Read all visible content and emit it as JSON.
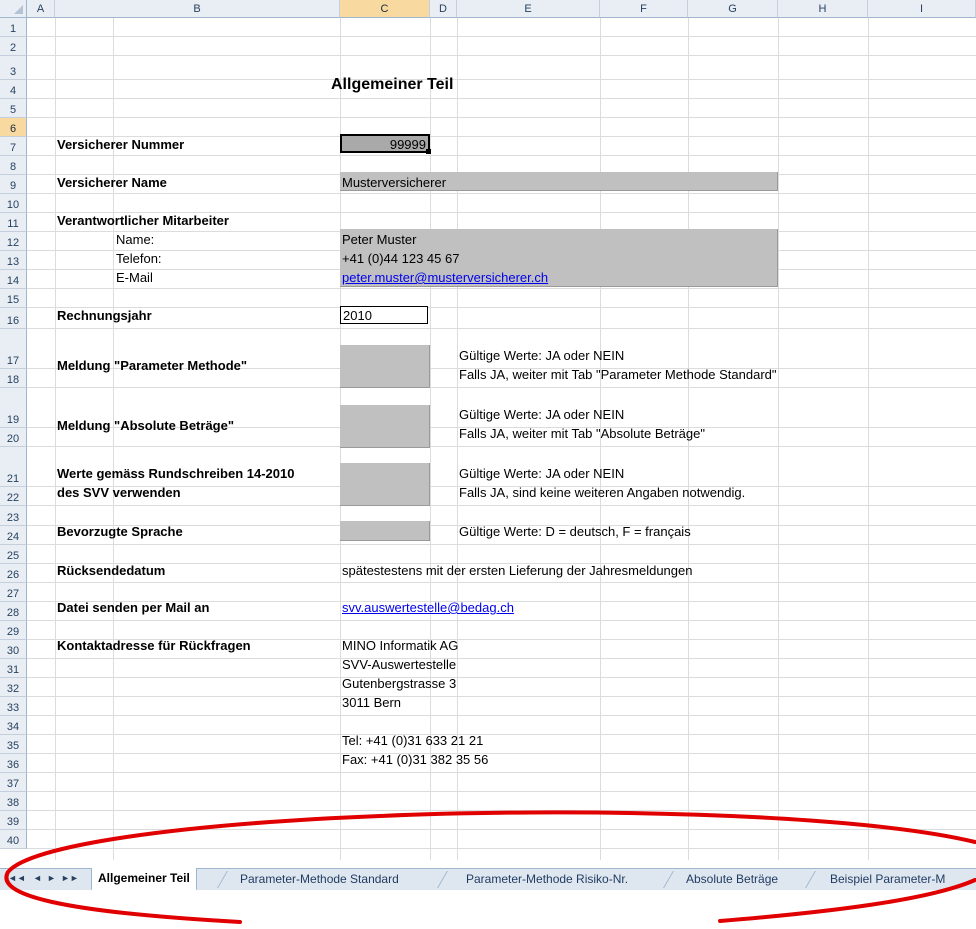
{
  "columns": [
    "A",
    "B",
    "C",
    "D",
    "E",
    "F",
    "G",
    "H",
    "I"
  ],
  "rows": [
    "1",
    "2",
    "3",
    "4",
    "5",
    "6",
    "7",
    "8",
    "9",
    "10",
    "11",
    "12",
    "13",
    "14",
    "15",
    "16",
    "17",
    "18",
    "19",
    "20",
    "21",
    "22",
    "23",
    "24",
    "25",
    "26",
    "27",
    "28",
    "29",
    "30",
    "31",
    "32",
    "33",
    "34",
    "35",
    "36",
    "37",
    "38",
    "39",
    "40"
  ],
  "title": "Allgemeiner Teil",
  "fields": {
    "versicherer_nummer_label": "Versicherer Nummer",
    "versicherer_nummer_value": "99999",
    "versicherer_name_label": "Versicherer Name",
    "versicherer_name_value": "Musterversicherer",
    "mitarbeiter_label": "Verantwortlicher Mitarbeiter",
    "name_label": "Name:",
    "name_value": "Peter Muster",
    "telefon_label": "Telefon:",
    "telefon_value": "+41 (0)44 123 45 67",
    "email_label": "E-Mail",
    "email_value": "peter.muster@musterversicherer.ch",
    "rechnungsjahr_label": "Rechnungsjahr",
    "rechnungsjahr_value": "2010",
    "param_methode_label": "Meldung \"Parameter Methode\"",
    "param_methode_hint1": "Gültige Werte: JA oder NEIN",
    "param_methode_hint2": "Falls JA, weiter mit Tab \"Parameter Methode Standard\"",
    "absolute_label": "Meldung \"Absolute Beträge\"",
    "absolute_hint1": "Gültige Werte: JA oder NEIN",
    "absolute_hint2": "Falls JA, weiter mit Tab \"Absolute Beträge\"",
    "werte_label1": "Werte gemäss Rundschreiben 14-2010",
    "werte_label2": "des SVV verwenden",
    "werte_hint1": "Gültige Werte: JA oder NEIN",
    "werte_hint2": "Falls JA, sind keine weiteren Angaben notwendig.",
    "sprache_label": "Bevorzugte Sprache",
    "sprache_hint": "Gültige Werte: D = deutsch, F = français",
    "ruecksende_label": "Rücksendedatum",
    "ruecksende_value": "spätestestens mit der ersten Lieferung der Jahresmeldungen",
    "datei_label": "Datei senden per Mail an",
    "datei_value": "svv.auswertestelle@bedag.ch",
    "kontakt_label": "Kontaktadresse für Rückfragen",
    "kontakt_line1": "MINO Informatik AG",
    "kontakt_line2": "SVV-Auswertestelle",
    "kontakt_line3": "Gutenbergstrasse 3",
    "kontakt_line4": "3011 Bern",
    "kontakt_tel": "Tel:  +41 (0)31 633 21 21",
    "kontakt_fax": "Fax: +41 (0)31 382 35 56"
  },
  "tabs": {
    "nav_first": "◄◄",
    "nav_prev": "◄",
    "nav_next": "►",
    "nav_last": "►►",
    "items": [
      "Allgemeiner Teil",
      "Parameter-Methode Standard",
      "Parameter-Methode Risiko-Nr.",
      "Absolute Beträge",
      "Beispiel Parameter-M"
    ]
  },
  "colors": {
    "input_fill": "#c0c0c0",
    "selected_header": "#f8d9a0",
    "annotation_ellipse": "#e00000"
  }
}
